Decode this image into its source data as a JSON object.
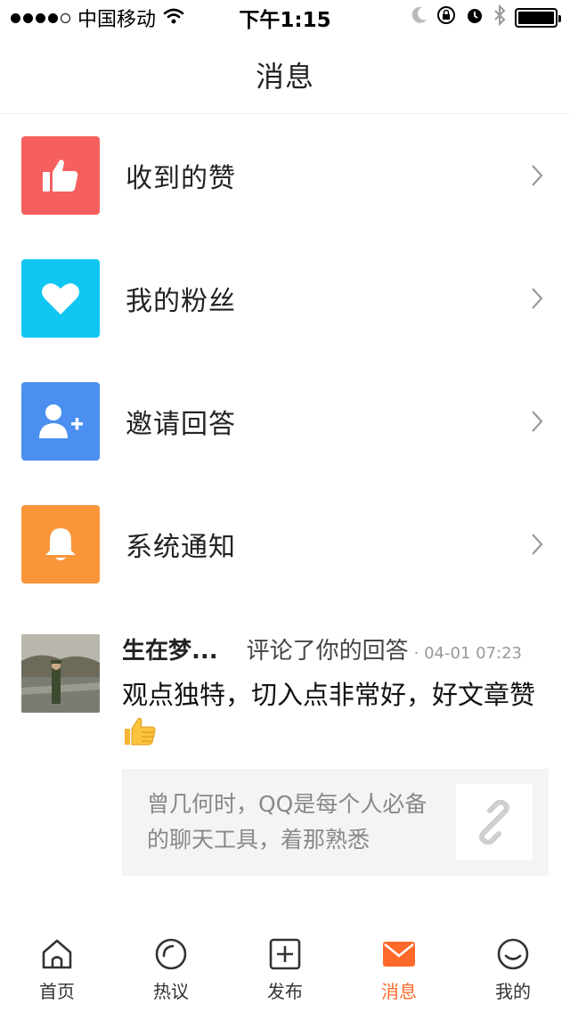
{
  "status_bar": {
    "carrier": "中国移动",
    "time": "下午1:15"
  },
  "nav": {
    "title": "消息"
  },
  "menu": [
    {
      "label": "收到的赞",
      "icon": "thumbs-up-icon",
      "color": "#f5605f"
    },
    {
      "label": "我的粉丝",
      "icon": "heart-icon",
      "color": "#10c6f3"
    },
    {
      "label": "邀请回答",
      "icon": "add-user-icon",
      "color": "#4b8ff0"
    },
    {
      "label": "系统通知",
      "icon": "bell-icon",
      "color": "#fb953a"
    }
  ],
  "comment": {
    "user": "生在梦...",
    "action": "评论了你的回答",
    "time": "· 04-01 07:23",
    "text": "观点独特，切入点非常好，好文章赞",
    "share_text": "曾几何时，QQ是每个人必备的聊天工具，着那熟悉"
  },
  "tabs": [
    {
      "label": "首页",
      "icon": "home-icon"
    },
    {
      "label": "热议",
      "icon": "circle-icon"
    },
    {
      "label": "发布",
      "icon": "plus-square-icon"
    },
    {
      "label": "消息",
      "icon": "mail-icon",
      "active": true
    },
    {
      "label": "我的",
      "icon": "profile-icon"
    }
  ],
  "colors": {
    "accent": "#ff6a2a"
  }
}
